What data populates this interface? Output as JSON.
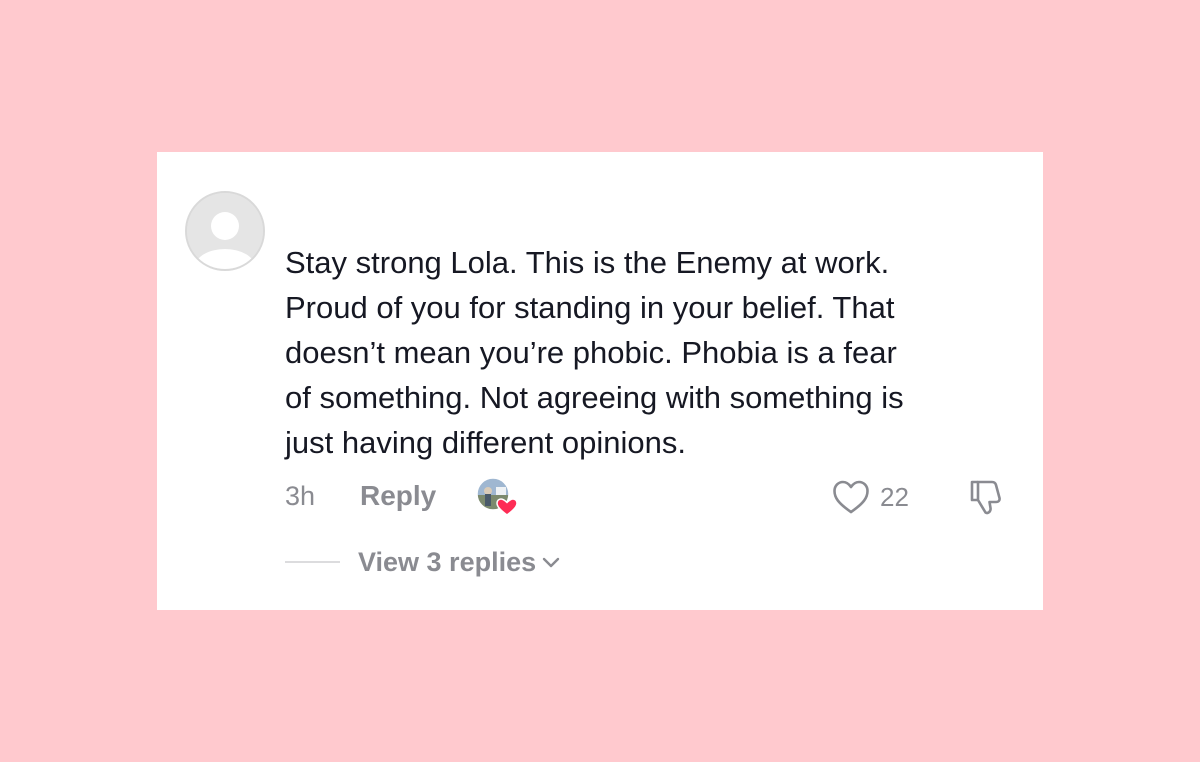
{
  "comment": {
    "text": "Stay strong Lola. This is the Enemy at work.\nProud of you for standing in your belief. That\ndoesn’t mean you’re phobic. Phobia is a fear\nof something. Not agreeing with something is\njust having different opinions.",
    "timestamp": "3h",
    "reply_label": "Reply",
    "like_count": "22",
    "view_replies_label": "View 3 replies"
  },
  "icons": {
    "avatar": "default-avatar-icon",
    "creator_liked": "creator-liked-badge-icon",
    "like": "heart-outline-icon",
    "dislike": "thumbs-down-icon",
    "expand": "chevron-down-icon"
  },
  "colors": {
    "background": "#ffc9ce",
    "card": "#ffffff",
    "text_primary": "#161823",
    "text_secondary": "#8a8b91",
    "heart_badge": "#fe2c55"
  }
}
